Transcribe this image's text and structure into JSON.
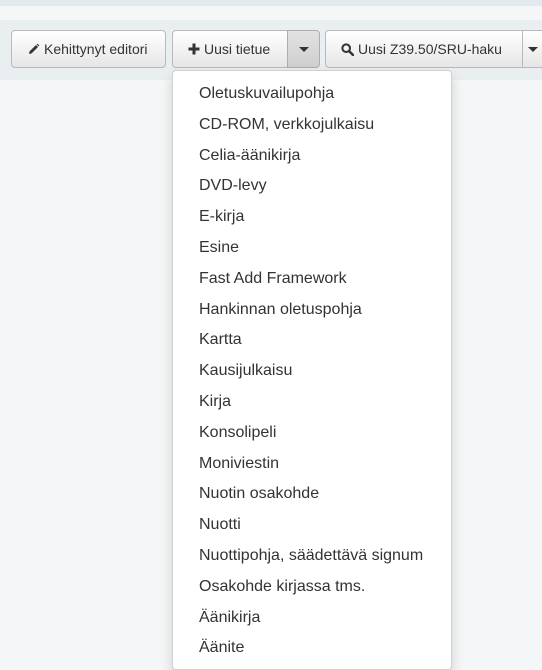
{
  "toolbar": {
    "advanced_editor_label": "Kehittynyt editori",
    "new_record_label": "Uusi tietue",
    "z3950_search_label": "Uusi Z39.50/SRU-haku"
  },
  "frameworks_menu": {
    "items": [
      "Oletuskuvailupohja",
      "CD-ROM, verkkojulkaisu",
      "Celia-äänikirja",
      "DVD-levy",
      "E-kirja",
      "Esine",
      "Fast Add Framework",
      "Hankinnan oletuspohja",
      "Kartta",
      "Kausijulkaisu",
      "Kirja",
      "Konsolipeli",
      "Moniviestin",
      "Nuotin osakohde",
      "Nuotti",
      "Nuottipohja, säädettävä signum",
      "Osakohde kirjassa tms.",
      "Äänikirja",
      "Äänite"
    ]
  },
  "icons": {
    "advanced_editor": "pencil-icon",
    "new_record": "plus-icon",
    "z3950_search": "search-icon"
  }
}
